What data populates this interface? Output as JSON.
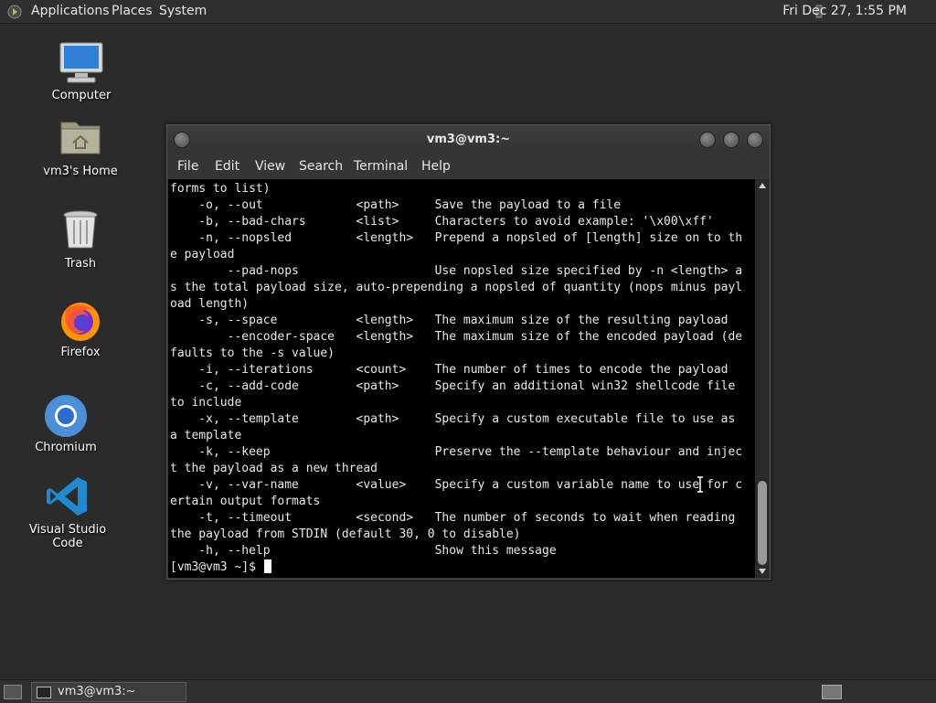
{
  "top_panel": {
    "menus": [
      "Applications",
      "Places",
      "System"
    ],
    "clock": "Fri Dec 27,  1:55 PM"
  },
  "desktop": {
    "icons": [
      {
        "label": "Computer",
        "icon": "computer-icon"
      },
      {
        "label": "vm3's Home",
        "icon": "home-folder-icon"
      },
      {
        "label": "Trash",
        "icon": "trash-icon"
      },
      {
        "label": "Firefox",
        "icon": "firefox-icon"
      },
      {
        "label": "Chromium",
        "icon": "chromium-icon"
      },
      {
        "label": "Visual Studio Code",
        "icon": "vscode-icon"
      }
    ]
  },
  "terminal": {
    "title": "vm3@vm3:~",
    "menu": [
      "File",
      "Edit",
      "View",
      "Search",
      "Terminal",
      "Help"
    ],
    "lines": [
      "forms to list)",
      "    -o, --out             <path>     Save the payload to a file",
      "    -b, --bad-chars       <list>     Characters to avoid example: '\\x00\\xff'",
      "    -n, --nopsled         <length>   Prepend a nopsled of [length] size on to th",
      "e payload",
      "        --pad-nops                   Use nopsled size specified by -n <length> a",
      "s the total payload size, auto-prepending a nopsled of quantity (nops minus payl",
      "oad length)",
      "    -s, --space           <length>   The maximum size of the resulting payload",
      "        --encoder-space   <length>   The maximum size of the encoded payload (de",
      "faults to the -s value)",
      "    -i, --iterations      <count>    The number of times to encode the payload",
      "    -c, --add-code        <path>     Specify an additional win32 shellcode file",
      "to include",
      "    -x, --template        <path>     Specify a custom executable file to use as",
      "a template",
      "    -k, --keep                       Preserve the --template behaviour and injec",
      "t the payload as a new thread",
      "    -v, --var-name        <value>    Specify a custom variable name to use for c",
      "ertain output formats",
      "    -t, --timeout         <second>   The number of seconds to wait when reading",
      "the payload from STDIN (default 30, 0 to disable)",
      "    -h, --help                       Show this message"
    ],
    "prompt": "[vm3@vm3 ~]$ "
  },
  "taskbar": {
    "task_label": "vm3@vm3:~"
  },
  "colors": {
    "desktop_bg": "#2b2b2b",
    "panel_bg": "#2f2f2f",
    "terminal_bg": "#000000",
    "terminal_fg": "#e8e8e8"
  }
}
